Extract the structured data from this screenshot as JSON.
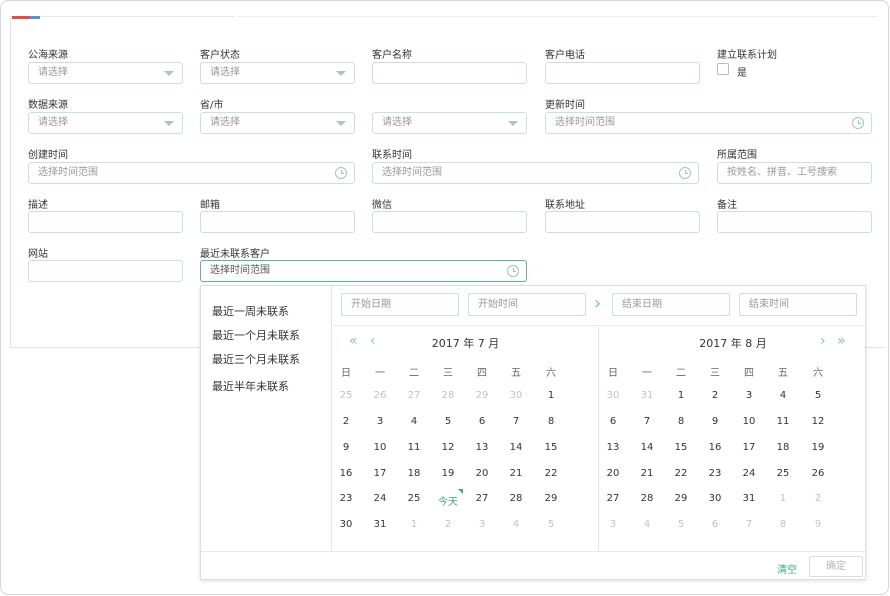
{
  "fields": {
    "sea_source": {
      "label": "公海来源",
      "placeholder": "请选择"
    },
    "customer_status": {
      "label": "客户状态",
      "placeholder": "请选择"
    },
    "customer_name": {
      "label": "客户名称",
      "value": ""
    },
    "customer_phone": {
      "label": "客户电话",
      "value": ""
    },
    "contact_plan": {
      "label": "建立联系计划",
      "checkbox_label": "是",
      "checked": false
    },
    "data_source": {
      "label": "数据来源",
      "placeholder": "请选择"
    },
    "province_city": {
      "label": "省/市",
      "placeholder": "请选择"
    },
    "city": {
      "placeholder": "请选择"
    },
    "update_time": {
      "label": "更新时间",
      "placeholder": "选择时间范围"
    },
    "create_time": {
      "label": "创建时间",
      "placeholder": "选择时间范围"
    },
    "contact_time": {
      "label": "联系时间",
      "placeholder": "选择时间范围"
    },
    "scope": {
      "label": "所属范围",
      "placeholder": "按姓名、拼音、工号搜索"
    },
    "description": {
      "label": "描述",
      "value": ""
    },
    "email": {
      "label": "邮箱",
      "value": ""
    },
    "wechat": {
      "label": "微信",
      "value": ""
    },
    "address": {
      "label": "联系地址",
      "value": ""
    },
    "remark": {
      "label": "备注",
      "value": ""
    },
    "website": {
      "label": "网站",
      "value": ""
    },
    "recent_uncontacted": {
      "label": "最近未联系客户",
      "placeholder": "选择时间范围"
    }
  },
  "picker": {
    "shortcuts": [
      "最近一周未联系",
      "最近一个月未联系",
      "最近三个月未联系",
      "最近半年未联系"
    ],
    "start_date_placeholder": "开始日期",
    "start_time_placeholder": "开始时间",
    "end_date_placeholder": "结束日期",
    "end_time_placeholder": "结束时间",
    "left_title": "2017 年 7 月",
    "right_title": "2017 年 8 月",
    "weekdays": [
      "日",
      "一",
      "二",
      "三",
      "四",
      "五",
      "六"
    ],
    "today_label": "今天",
    "left_days": [
      [
        "25",
        "26",
        "27",
        "28",
        "29",
        "30",
        "1"
      ],
      [
        "2",
        "3",
        "4",
        "5",
        "6",
        "7",
        "8"
      ],
      [
        "9",
        "10",
        "11",
        "12",
        "13",
        "14",
        "15"
      ],
      [
        "16",
        "17",
        "18",
        "19",
        "20",
        "21",
        "22"
      ],
      [
        "23",
        "24",
        "25",
        "今天",
        "27",
        "28",
        "29"
      ],
      [
        "30",
        "31",
        "1",
        "2",
        "3",
        "4",
        "5"
      ]
    ],
    "left_muted": [
      [
        true,
        true,
        true,
        true,
        true,
        true,
        false
      ],
      [
        false,
        false,
        false,
        false,
        false,
        false,
        false
      ],
      [
        false,
        false,
        false,
        false,
        false,
        false,
        false
      ],
      [
        false,
        false,
        false,
        false,
        false,
        false,
        false
      ],
      [
        false,
        false,
        false,
        false,
        false,
        false,
        false
      ],
      [
        false,
        false,
        true,
        true,
        true,
        true,
        true
      ]
    ],
    "right_days": [
      [
        "30",
        "31",
        "1",
        "2",
        "3",
        "4",
        "5"
      ],
      [
        "6",
        "7",
        "8",
        "9",
        "10",
        "11",
        "12"
      ],
      [
        "13",
        "14",
        "15",
        "16",
        "17",
        "18",
        "19"
      ],
      [
        "20",
        "21",
        "22",
        "23",
        "24",
        "25",
        "26"
      ],
      [
        "27",
        "28",
        "29",
        "30",
        "31",
        "1",
        "2"
      ],
      [
        "3",
        "4",
        "5",
        "6",
        "7",
        "8",
        "9"
      ]
    ],
    "right_muted": [
      [
        true,
        true,
        false,
        false,
        false,
        false,
        false
      ],
      [
        false,
        false,
        false,
        false,
        false,
        false,
        false
      ],
      [
        false,
        false,
        false,
        false,
        false,
        false,
        false
      ],
      [
        false,
        false,
        false,
        false,
        false,
        false,
        false
      ],
      [
        false,
        false,
        false,
        false,
        false,
        true,
        true
      ],
      [
        true,
        true,
        true,
        true,
        true,
        true,
        true
      ]
    ],
    "clear_label": "清空",
    "confirm_label": "确定"
  },
  "colors": {
    "accent": "#3faa79",
    "border": "#c9e2d6",
    "muted": "#c2c2c2"
  }
}
